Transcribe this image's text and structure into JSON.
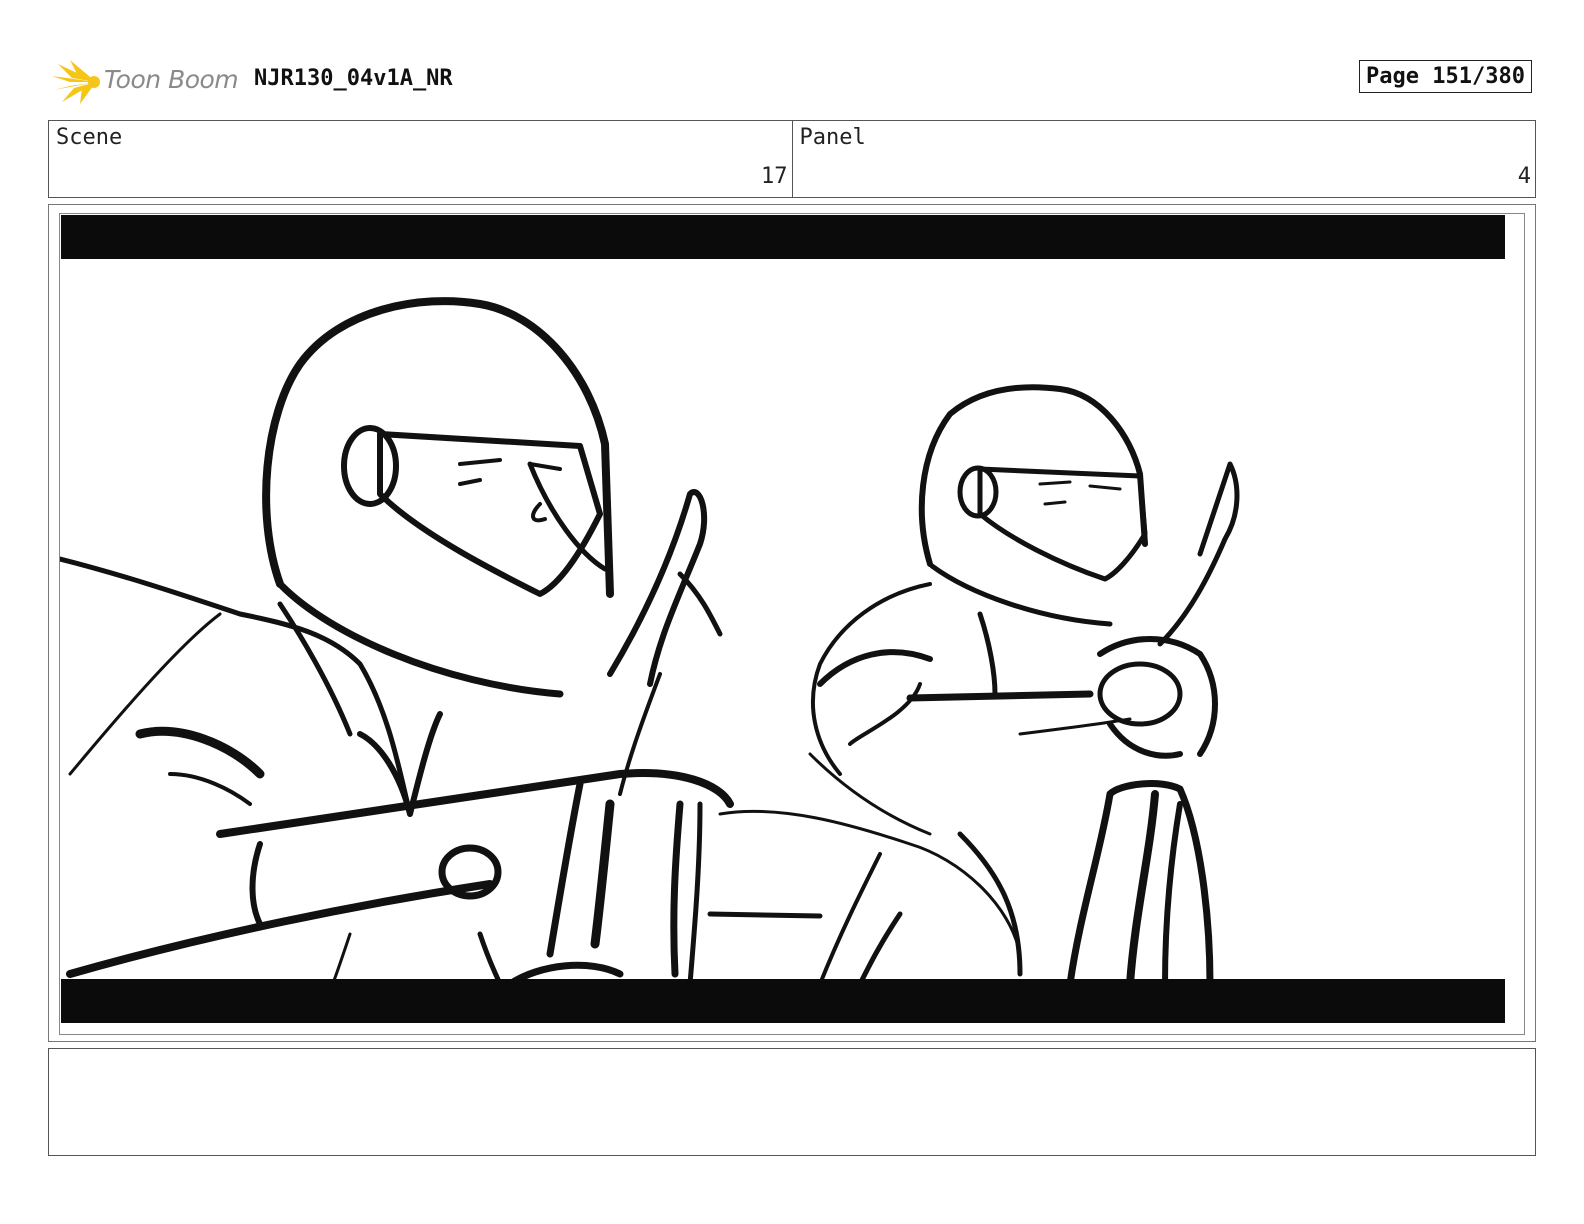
{
  "header": {
    "logo_text": "Toon Boom",
    "project_title": "NJR130_04v1A_NR",
    "page_label": "Page 151/380"
  },
  "info": {
    "scene_label": "Scene",
    "scene_value": "17",
    "panel_label": "Panel",
    "panel_value": "4"
  },
  "notes": {
    "text": ""
  },
  "colors": {
    "logo_burst": "#f5c518",
    "logo_text": "#8a8a8a",
    "ink": "#111111"
  }
}
